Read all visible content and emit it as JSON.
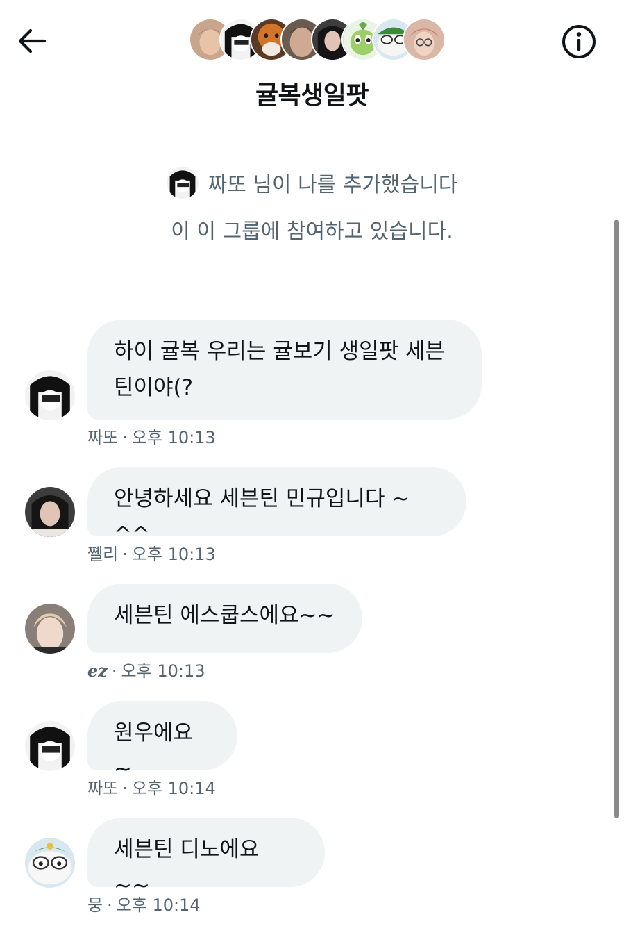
{
  "header": {
    "back_icon": "arrow-left-icon",
    "info_icon": "info-circle-icon",
    "title": "귤복생일팟",
    "member_avatars": 8
  },
  "system": {
    "added_text": "짜또 님이 나를 추가했습니다",
    "joined_text": "이 이 그룹에 참여하고 있습니다."
  },
  "messages": [
    {
      "sender": "짜또",
      "time": "오후 10:13",
      "text": "하이 귤복 우리는 귤보기 생일팟 세븐틴이야(?"
    },
    {
      "sender": "쪨리",
      "time": "오후 10:13",
      "text": "안녕하세요 세븐틴 민규입니다 ~ ^^"
    },
    {
      "sender": "ez",
      "time": "오후 10:13",
      "text": "세븐틴 에스쿱스에요~~"
    },
    {
      "sender": "짜또",
      "time": "오후 10:14",
      "text": "원우에요~"
    },
    {
      "sender": "뭉",
      "time": "오후 10:14",
      "text": "세븐틴 디노에요 ~~"
    }
  ],
  "meta_separator": "·",
  "colors": {
    "bubble": "#eff3f4",
    "secondary_text": "#536471",
    "primary_text": "#0f1419"
  }
}
